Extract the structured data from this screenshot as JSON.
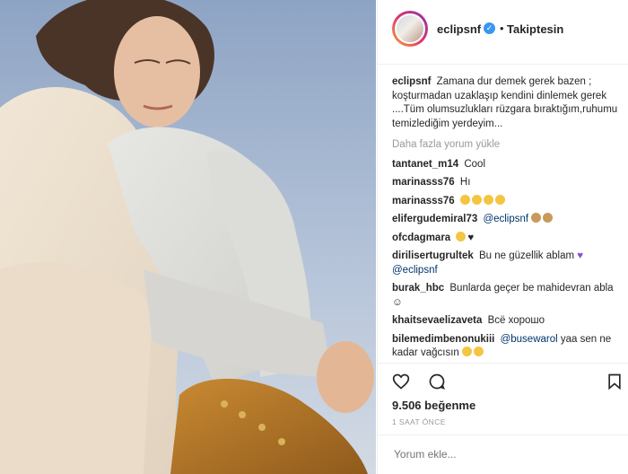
{
  "post": {
    "username": "eclipsnf",
    "verified": true,
    "separator": "•",
    "follow_label": "Takiptesin",
    "caption_user": "eclipsnf",
    "caption_text": "Zamana dur demek gerek bazen ; koşturmadan uzaklaşıp kendini dinlemek gerek ....Tüm olumsuzlukları rüzgara bıraktığım,ruhumu temizlediğim yerdeyim...",
    "load_more": "Daha fazla yorum yükle",
    "comments": [
      {
        "user": "tantanet_m14",
        "text": "Cool"
      },
      {
        "user": "marinasss76",
        "text": "Hı"
      },
      {
        "user": "marinasss76",
        "emoji": [
          "face-emoji",
          "face-emoji",
          "face-emoji",
          "face-emoji"
        ]
      },
      {
        "user": "elifergudemiral73",
        "mention": "@eclipsnf",
        "emoji": [
          "praying-hands-emoji",
          "praying-hands-emoji"
        ]
      },
      {
        "user": "ofcdagmara",
        "emoji": [
          "ok-hand-emoji",
          "black-heart-emoji"
        ]
      },
      {
        "user": "dirilisertugrultek",
        "text": "Bu ne güzellik ablam",
        "emoji": [
          "purple-heart-emoji"
        ],
        "mention": "@eclipsnf"
      },
      {
        "user": "burak_hbc",
        "text": "Bunlarda geçer be mahidevran abla☺"
      },
      {
        "user": "khaitsevaelizaveta",
        "text": "Всё хорошо"
      },
      {
        "user": "bilemedimbenonukiii",
        "mention": "@busewarol",
        "text": "yaa sen ne kadar vağcısın",
        "emoji": [
          "face-emoji",
          "face-emoji"
        ]
      }
    ],
    "actions": [
      "heart-icon",
      "comment-icon",
      "bookmark-icon"
    ],
    "likes": "9.506 beğenme",
    "time": "1 SAAT ÖNCE",
    "comment_placeholder": "Yorum ekle..."
  },
  "colors": {
    "mention": "#003569",
    "verified": "#3897f0",
    "muted": "#999999"
  }
}
